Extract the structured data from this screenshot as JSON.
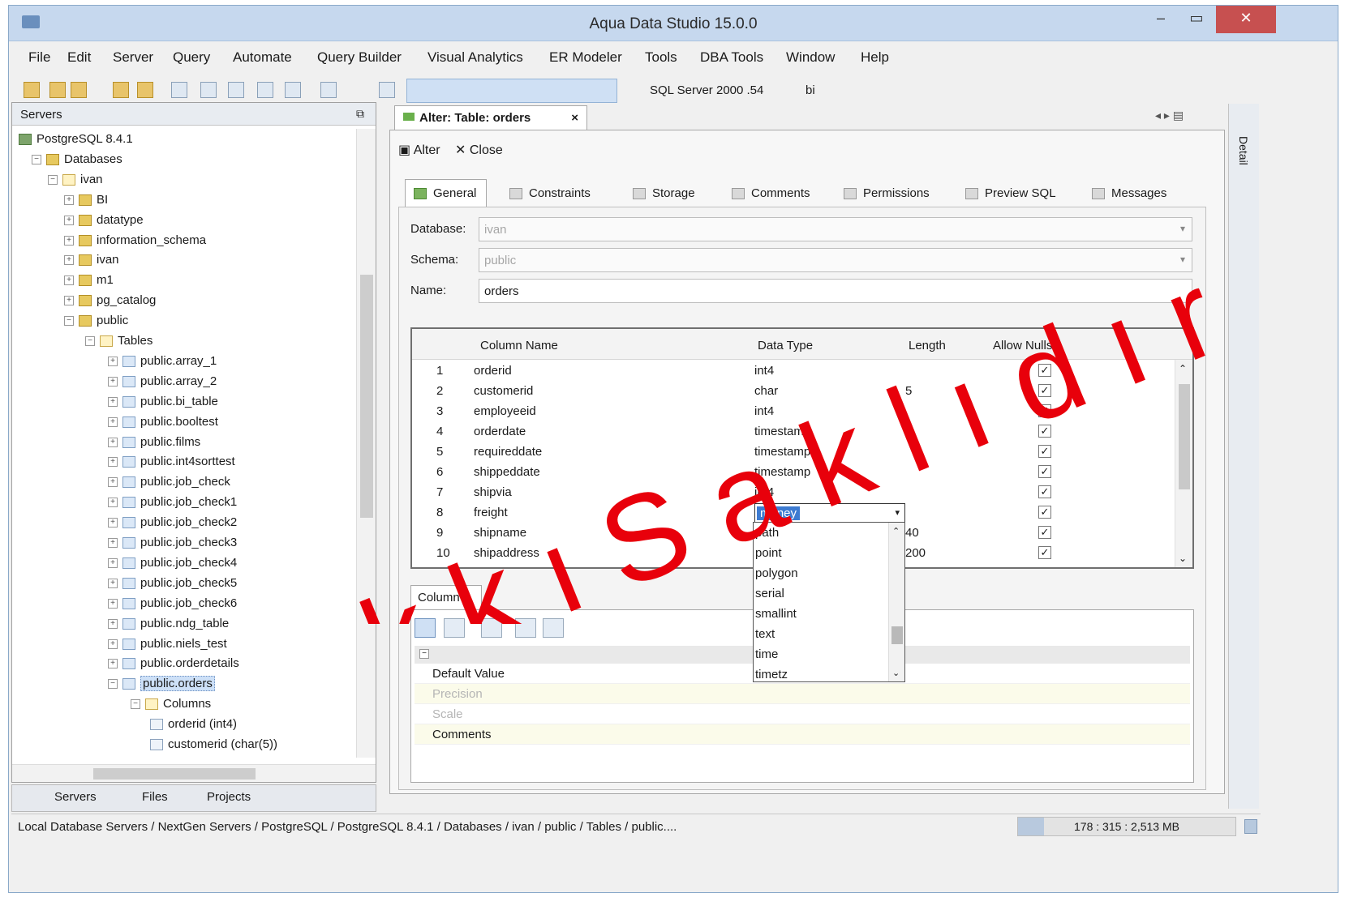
{
  "window": {
    "title": "Aqua Data Studio 15.0.0",
    "controls": {
      "minimize": "–",
      "maximize": "▭",
      "close": "✕"
    }
  },
  "menu": [
    "File",
    "Edit",
    "Server",
    "Query",
    "Automate",
    "Query Builder",
    "Visual Analytics",
    "ER Modeler",
    "Tools",
    "DBA Tools",
    "Window",
    "Help"
  ],
  "toolbar": {
    "server_select": "SQL Server 2000 .54",
    "db_select": "bi"
  },
  "servers_panel": {
    "title": "Servers",
    "tree": [
      {
        "label": "PostgreSQL 8.4.1",
        "icon": "server-icon"
      },
      {
        "label": "Databases",
        "icon": "database-icon"
      },
      {
        "label": "ivan",
        "icon": "folder-icon"
      },
      {
        "label": "BI",
        "icon": "schema-icon"
      },
      {
        "label": "datatype",
        "icon": "schema-icon"
      },
      {
        "label": "information_schema",
        "icon": "schema-icon"
      },
      {
        "label": "ivan",
        "icon": "schema-icon"
      },
      {
        "label": "m1",
        "icon": "schema-icon"
      },
      {
        "label": "pg_catalog",
        "icon": "schema-icon"
      },
      {
        "label": "public",
        "icon": "schema-icon"
      },
      {
        "label": "Tables",
        "icon": "folder-icon"
      },
      {
        "label": "public.array_1",
        "icon": "table-icon"
      },
      {
        "label": "public.array_2",
        "icon": "table-icon"
      },
      {
        "label": "public.bi_table",
        "icon": "table-icon"
      },
      {
        "label": "public.booltest",
        "icon": "table-icon"
      },
      {
        "label": "public.films",
        "icon": "table-icon"
      },
      {
        "label": "public.int4sorttest",
        "icon": "table-icon"
      },
      {
        "label": "public.job_check",
        "icon": "table-icon"
      },
      {
        "label": "public.job_check1",
        "icon": "table-icon"
      },
      {
        "label": "public.job_check2",
        "icon": "table-icon"
      },
      {
        "label": "public.job_check3",
        "icon": "table-icon"
      },
      {
        "label": "public.job_check4",
        "icon": "table-icon"
      },
      {
        "label": "public.job_check5",
        "icon": "table-icon"
      },
      {
        "label": "public.job_check6",
        "icon": "table-icon"
      },
      {
        "label": "public.ndg_table",
        "icon": "table-icon"
      },
      {
        "label": "public.niels_test",
        "icon": "table-icon"
      },
      {
        "label": "public.orderdetails",
        "icon": "table-icon"
      },
      {
        "label": "public.orders",
        "icon": "table-icon"
      },
      {
        "label": "Columns",
        "icon": "folder-icon"
      },
      {
        "label": "orderid (int4)",
        "icon": "column-icon"
      },
      {
        "label": "customerid (char(5))",
        "icon": "column-icon"
      }
    ],
    "bottom_tabs": [
      "Servers",
      "Files",
      "Projects"
    ]
  },
  "editor": {
    "tab_title": "Alter: Table: orders",
    "tab_close": "×",
    "nav": "◂ ▸ ▤",
    "actions": {
      "alter": "Alter",
      "close": "Close"
    },
    "subtabs": [
      "General",
      "Constraints",
      "Storage",
      "Comments",
      "Permissions",
      "Preview SQL",
      "Messages"
    ],
    "database_label": "Database:",
    "database_value": "ivan",
    "schema_label": "Schema:",
    "schema_value": "public",
    "name_label": "Name:",
    "name_value": "orders",
    "grid_headers": [
      "Column Name",
      "Data Type",
      "Length",
      "Allow Nulls"
    ],
    "rows": [
      {
        "n": "1",
        "name": "orderid",
        "type": "int4",
        "len": ""
      },
      {
        "n": "2",
        "name": "customerid",
        "type": "char",
        "len": "5"
      },
      {
        "n": "3",
        "name": "employeeid",
        "type": "int4",
        "len": ""
      },
      {
        "n": "4",
        "name": "orderdate",
        "type": "timestamp",
        "len": ""
      },
      {
        "n": "5",
        "name": "requireddate",
        "type": "timestamp",
        "len": ""
      },
      {
        "n": "6",
        "name": "shippeddate",
        "type": "timestamp",
        "len": ""
      },
      {
        "n": "7",
        "name": "shipvia",
        "type": "int4",
        "len": ""
      },
      {
        "n": "8",
        "name": "freight",
        "type": "money",
        "len": ""
      },
      {
        "n": "9",
        "name": "shipname",
        "type": "",
        "len": "40"
      },
      {
        "n": "10",
        "name": "shipaddress",
        "type": "",
        "len": "200"
      }
    ],
    "dropdown_options": [
      "path",
      "point",
      "polygon",
      "serial",
      "smallint",
      "text",
      "time",
      "timetz"
    ],
    "column_tab": "Column",
    "properties": [
      "Default Value",
      "Precision",
      "Scale",
      "Comments"
    ],
    "detail_label": "Detail"
  },
  "status": {
    "path": "Local Database Servers / NextGen Servers / PostgreSQL / PostgreSQL 8.4.1 / Databases / ivan / public / Tables / public....",
    "memory": "178 : 315 : 2,513 MB",
    "memory_fraction": 0.12
  },
  "watermark": {
    "text": "f H a k k ı  S a k l ı d ı r",
    "color": "#e8000b"
  }
}
